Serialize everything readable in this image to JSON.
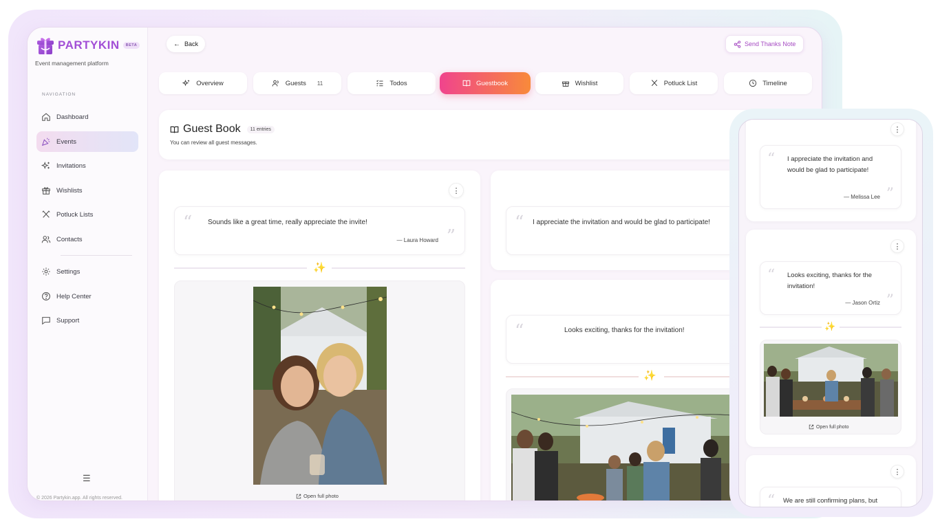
{
  "app": {
    "name": "PARTYKIN",
    "badge": "BETA",
    "tagline": "Event management platform",
    "copyright": "© 2026 Partykin.app. All rights reserved."
  },
  "sidebar": {
    "section_title": "NAVIGATION",
    "items": [
      {
        "label": "Dashboard",
        "icon": "home-icon"
      },
      {
        "label": "Events",
        "icon": "party-popper-icon",
        "active": true
      },
      {
        "label": "Invitations",
        "icon": "sparkles-icon"
      },
      {
        "label": "Wishlists",
        "icon": "gift-icon"
      },
      {
        "label": "Potluck Lists",
        "icon": "utensils-icon"
      },
      {
        "label": "Contacts",
        "icon": "users-icon"
      }
    ],
    "footer_items": [
      {
        "label": "Settings",
        "icon": "gear-icon"
      },
      {
        "label": "Help Center",
        "icon": "help-circle-icon"
      },
      {
        "label": "Support",
        "icon": "message-icon"
      }
    ],
    "menu_icon": "hamburger-icon"
  },
  "header": {
    "back_label": "Back",
    "send_label": "Send Thanks Note"
  },
  "tabs": [
    {
      "label": "Overview",
      "icon": "sparkles-icon"
    },
    {
      "label": "Guests",
      "icon": "users-icon",
      "count": "11"
    },
    {
      "label": "Todos",
      "icon": "checklist-icon"
    },
    {
      "label": "Guestbook",
      "icon": "book-open-icon",
      "active": true
    },
    {
      "label": "Wishlist",
      "icon": "gift-icon"
    },
    {
      "label": "Potluck List",
      "icon": "utensils-icon"
    },
    {
      "label": "Timeline",
      "icon": "clock-icon"
    }
  ],
  "guestbook": {
    "title": "Guest Book",
    "entries_label": "11 entries",
    "subtitle": "You can review all guest messages."
  },
  "entries": [
    {
      "message": "Sounds like a great time, really appreciate the invite!",
      "author": "— Laura Howard",
      "photo": "Two smiling women taking a selfie in a backyard with string lights",
      "open_photo": "Open full photo"
    },
    {
      "message": "I appreciate the invitation and would be glad to participate!",
      "author": ""
    },
    {
      "message": "Looks exciting, thanks for the invitation!",
      "author": "",
      "photo": "Group of friends at a backyard party with string lights and a fire pit"
    }
  ],
  "mobile_entries": [
    {
      "message": "I appreciate the invitation and would be glad to participate!",
      "author": "— Melissa Lee"
    },
    {
      "message": "Looks exciting, thanks for the invitation!",
      "author": "— Jason Ortiz",
      "photo": "Friends mingling around a backyard table",
      "open_photo": "Open full photo"
    },
    {
      "message": "We are still confirming plans, but"
    }
  ],
  "colors": {
    "brand": "#a24fd6",
    "accent_start": "#f0448d",
    "accent_end": "#f88a3a",
    "sparkle": "#f5c23a"
  }
}
